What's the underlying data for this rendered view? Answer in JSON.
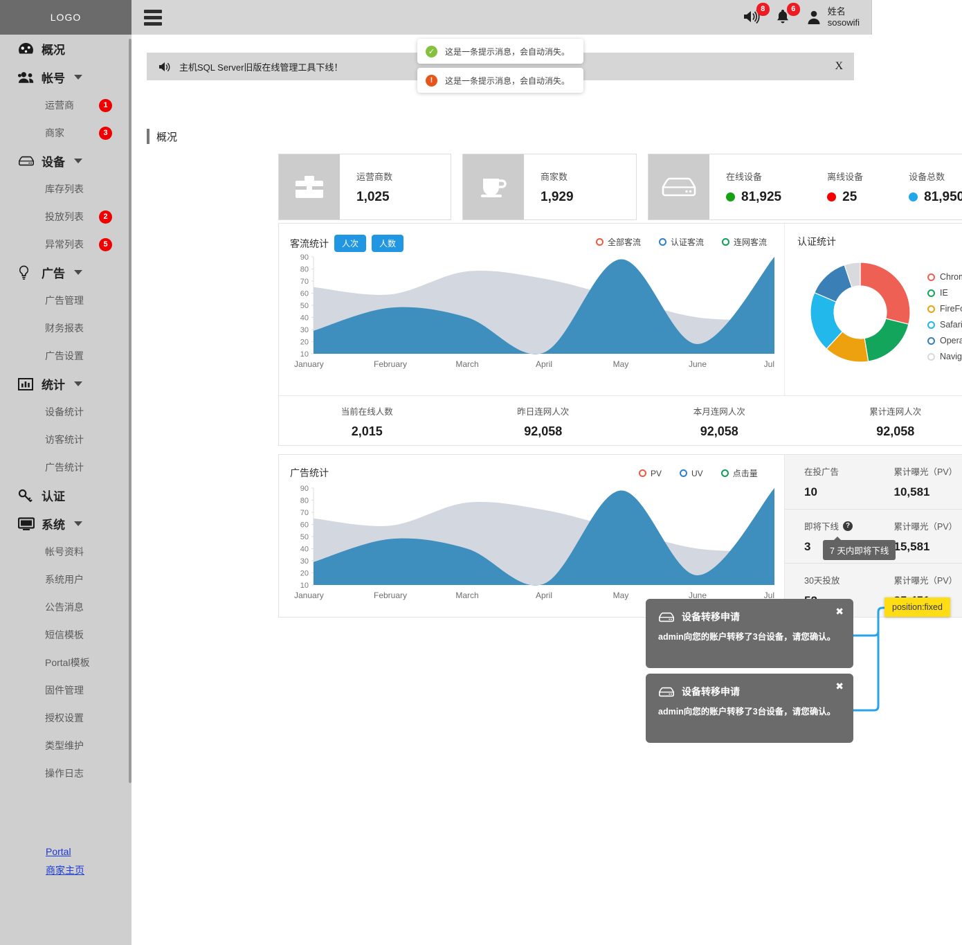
{
  "brand": {
    "logo": "LOGO"
  },
  "sidebar": {
    "groups": [
      {
        "icon": "dashboard-icon",
        "label": "概况",
        "expandable": false,
        "children": []
      },
      {
        "icon": "users-icon",
        "label": "帐号",
        "expandable": true,
        "children": [
          {
            "label": "运营商",
            "badge": "1"
          },
          {
            "label": "商家",
            "badge": "3"
          }
        ]
      },
      {
        "icon": "device-icon",
        "label": "设备",
        "expandable": true,
        "children": [
          {
            "label": "库存列表",
            "badge": ""
          },
          {
            "label": "投放列表",
            "badge": "2"
          },
          {
            "label": "异常列表",
            "badge": "5"
          }
        ]
      },
      {
        "icon": "bulb-icon",
        "label": "广告",
        "expandable": true,
        "children": [
          {
            "label": "广告管理",
            "badge": ""
          },
          {
            "label": "财务报表",
            "badge": ""
          },
          {
            "label": "广告设置",
            "badge": ""
          }
        ]
      },
      {
        "icon": "bars-icon",
        "label": "统计",
        "expandable": true,
        "children": [
          {
            "label": "设备统计",
            "badge": ""
          },
          {
            "label": "访客统计",
            "badge": ""
          },
          {
            "label": "广告统计",
            "badge": ""
          }
        ]
      },
      {
        "icon": "key-icon",
        "label": "认证",
        "expandable": false,
        "children": []
      },
      {
        "icon": "monitor-icon",
        "label": "系统",
        "expandable": true,
        "children": [
          {
            "label": "帐号资料",
            "badge": ""
          },
          {
            "label": "系统用户",
            "badge": ""
          },
          {
            "label": "公告消息",
            "badge": ""
          },
          {
            "label": "短信模板",
            "badge": ""
          },
          {
            "label": "Portal模板",
            "badge": ""
          },
          {
            "label": "固件管理",
            "badge": ""
          },
          {
            "label": "授权设置",
            "badge": ""
          },
          {
            "label": "类型维护",
            "badge": ""
          },
          {
            "label": "操作日志",
            "badge": ""
          }
        ]
      }
    ],
    "links": [
      {
        "label": "Portal"
      },
      {
        "label": "商家主页"
      }
    ]
  },
  "topbar": {
    "menu_icon": "hamburger-icon",
    "speaker_badge": "8",
    "bell_badge": "6",
    "user_name": "姓名",
    "user_account": "sosowifi"
  },
  "notice": {
    "icon": "speaker-icon",
    "text": "主机SQL Server旧版在线管理工具下线！",
    "close": "X"
  },
  "toasts": [
    {
      "type": "success",
      "glyph": "✓",
      "color": "#84c13c",
      "text": "这是一条提示消息，会自动消失。"
    },
    {
      "type": "warning",
      "glyph": "!",
      "color": "#e8551a",
      "text": "这是一条提示消息，会自动消失。"
    }
  ],
  "page": {
    "title": "概况"
  },
  "stat_cards": [
    {
      "icon": "briefcase-icon",
      "columns": [
        {
          "label": "运营商数",
          "value": "1,025",
          "dot": ""
        }
      ]
    },
    {
      "icon": "cup-icon",
      "columns": [
        {
          "label": "商家数",
          "value": "1,929",
          "dot": ""
        }
      ]
    },
    {
      "icon": "server-icon",
      "columns": [
        {
          "label": "在线设备",
          "value": "81,925",
          "dot": "#16a013"
        },
        {
          "label": "离线设备",
          "value": "25",
          "dot": "#f40000"
        },
        {
          "label": "设备总数",
          "value": "81,950",
          "dot": "#22a7e8"
        }
      ]
    }
  ],
  "traffic_panel": {
    "title": "客流统计",
    "tabs": [
      {
        "label": "人次",
        "active": true
      },
      {
        "label": "人数",
        "active": true
      }
    ],
    "legend": [
      {
        "label": "全部客流",
        "color": "#ee5a43"
      },
      {
        "label": "认证客流",
        "color": "#2f7fd0"
      },
      {
        "label": "连网客流",
        "color": "#0f9d58"
      }
    ],
    "summary": [
      {
        "label": "当前在线人数",
        "value": "2,015"
      },
      {
        "label": "昨日连网人次",
        "value": "92,058"
      },
      {
        "label": "本月连网人次",
        "value": "92,058"
      },
      {
        "label": "累计连网人次",
        "value": "92,058"
      }
    ]
  },
  "auth_panel": {
    "title": "认证统计"
  },
  "ads_panel": {
    "title": "广告统计",
    "legend": [
      {
        "label": "PV",
        "color": "#ee5a43"
      },
      {
        "label": "UV",
        "color": "#2f7fd0"
      },
      {
        "label": "点击量",
        "color": "#0f9d58"
      }
    ],
    "rows": [
      {
        "label_left": "在投广告",
        "value_left": "10",
        "has_help": false,
        "label_right": "累计曝光（PV）",
        "value_right": "10,581"
      },
      {
        "label_left": "即将下线",
        "value_left": "3",
        "has_help": true,
        "label_right": "累计曝光（PV）",
        "value_right": "15,581"
      },
      {
        "label_left": "30天投放",
        "value_left": "52",
        "has_help": false,
        "label_right": "累计曝光（PV）",
        "value_right": "35,451"
      }
    ],
    "tooltip": "7 天内即将下线"
  },
  "device_toasts": [
    {
      "icon": "device-icon",
      "title": "设备转移申请",
      "body": "admin向您的账户转移了3台设备，请您确认。",
      "close": "✖"
    },
    {
      "icon": "device-icon",
      "title": "设备转移申请",
      "body": "admin向您的账户转移了3台设备，请您确认。",
      "close": "✖"
    }
  ],
  "annotation": {
    "label": "position:fixed",
    "color": "#ffdd15"
  },
  "chart_data": [
    {
      "type": "area",
      "title": "客流统计",
      "categories": [
        "January",
        "February",
        "March",
        "April",
        "May",
        "June",
        "July"
      ],
      "x": [
        0,
        1,
        2,
        3,
        4,
        5,
        6
      ],
      "series": [
        {
          "name": "全部客流",
          "color": "#d3d7df",
          "values": [
            65,
            59,
            78,
            72,
            56,
            40,
            38
          ]
        },
        {
          "name": "认证客流",
          "color": "#3e8fbe",
          "values": [
            29,
            48,
            40,
            11,
            88,
            18,
            90
          ]
        }
      ],
      "xlabel": "",
      "ylabel": "",
      "ylim": [
        10,
        90
      ],
      "yticks": [
        10,
        20,
        30,
        40,
        50,
        60,
        70,
        80,
        90
      ],
      "grid": false,
      "legend": "top-right"
    },
    {
      "type": "pie",
      "title": "认证统计",
      "donut": true,
      "labels": [
        "Chrome",
        "IE",
        "FireFox",
        "Safari",
        "Opera",
        "Navigator"
      ],
      "values": [
        28,
        18,
        14,
        19,
        13,
        5
      ],
      "colors": [
        "#ef6054",
        "#13a55c",
        "#eda10f",
        "#22b8ec",
        "#3a7fb5",
        "#d8dade"
      ],
      "legend": "right"
    },
    {
      "type": "area",
      "title": "广告统计",
      "categories": [
        "January",
        "February",
        "March",
        "April",
        "May",
        "June",
        "July"
      ],
      "x": [
        0,
        1,
        2,
        3,
        4,
        5,
        6
      ],
      "series": [
        {
          "name": "PV",
          "color": "#d3d7df",
          "values": [
            65,
            59,
            78,
            72,
            56,
            40,
            38
          ]
        },
        {
          "name": "UV",
          "color": "#3e8fbe",
          "values": [
            29,
            48,
            40,
            11,
            88,
            18,
            90
          ]
        }
      ],
      "xlabel": "",
      "ylabel": "",
      "ylim": [
        10,
        90
      ],
      "yticks": [
        10,
        20,
        30,
        40,
        50,
        60,
        70,
        80,
        90
      ],
      "grid": false,
      "legend": "top-right"
    }
  ]
}
